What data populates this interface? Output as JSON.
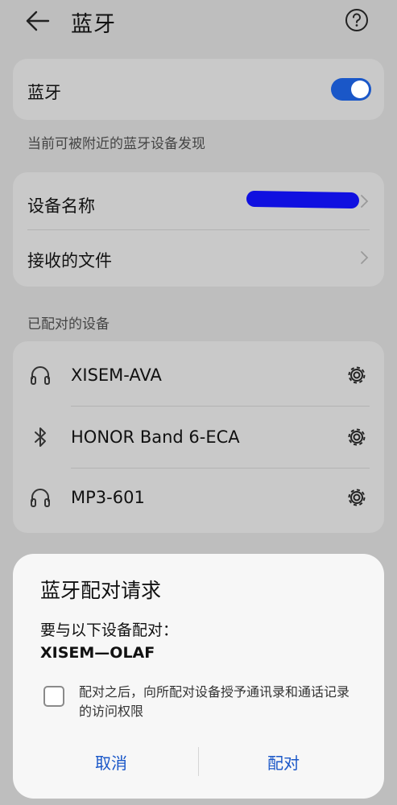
{
  "header": {
    "title": "蓝牙",
    "back_icon": "arrow-left-icon",
    "help_icon": "help-circle-icon"
  },
  "bluetooth": {
    "label": "蓝牙",
    "enabled": true,
    "accent": "#1a57c8"
  },
  "visibility_note": "当前可被附近的蓝牙设备发现",
  "settings": {
    "device_name_label": "设备名称",
    "received_files_label": "接收的文件"
  },
  "paired_section_label": "已配对的设备",
  "paired_devices": [
    {
      "name": "XISEM-AVA",
      "icon": "headphones-icon"
    },
    {
      "name": "HONOR Band 6-ECA",
      "icon": "bluetooth-icon"
    },
    {
      "name": "MP3-601",
      "icon": "headphones-icon"
    }
  ],
  "dialog": {
    "title": "蓝牙配对请求",
    "subtitle": "要与以下设备配对：",
    "device": "XISEM—OLAF",
    "checkbox_text": "配对之后，向所配对设备授予通讯录和通话记录的访问权限",
    "checkbox_checked": false,
    "cancel_label": "取消",
    "pair_label": "配对"
  }
}
